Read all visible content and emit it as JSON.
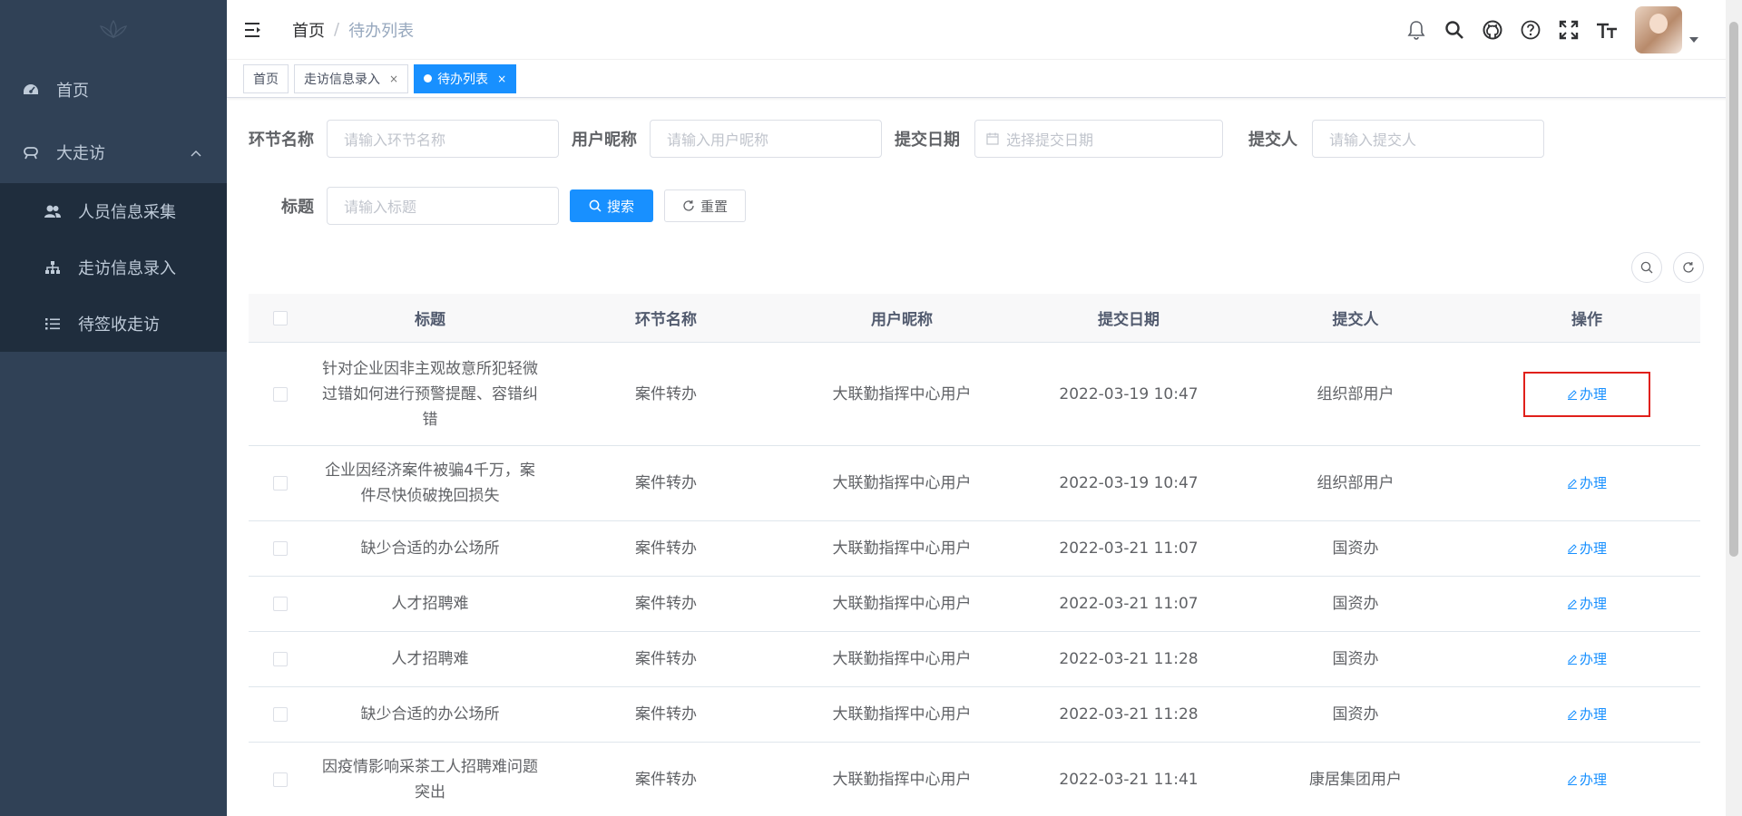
{
  "sidebar": {
    "menu": [
      {
        "label": "首页",
        "icon": "dashboard-icon"
      },
      {
        "label": "大走访",
        "icon": "visit-icon"
      }
    ],
    "submenu": [
      {
        "label": "人员信息采集",
        "icon": "peoples-icon"
      },
      {
        "label": "走访信息录入",
        "icon": "tree-icon"
      },
      {
        "label": "待签收走访",
        "icon": "list-icon"
      }
    ]
  },
  "breadcrumb": {
    "home": "首页",
    "sep": "/",
    "current": "待办列表"
  },
  "tags": [
    {
      "label": "首页"
    },
    {
      "label": "走访信息录入"
    },
    {
      "label": "待办列表"
    }
  ],
  "tag_close": "×",
  "filter": {
    "node_label": "环节名称",
    "node_placeholder": "请输入环节名称",
    "user_label": "用户昵称",
    "user_placeholder": "请输入用户昵称",
    "date_label": "提交日期",
    "date_placeholder": "选择提交日期",
    "submitter_label": "提交人",
    "submitter_placeholder": "请输入提交人",
    "title_label": "标题",
    "title_placeholder": "请输入标题",
    "search_label": "搜索",
    "reset_label": "重置"
  },
  "table": {
    "headers": [
      "标题",
      "环节名称",
      "用户昵称",
      "提交日期",
      "提交人",
      "操作"
    ],
    "op_label": "办理",
    "rows": [
      {
        "title": "针对企业因非主观故意所犯轻微过错如何进行预警提醒、容错纠错",
        "node": "案件转办",
        "user": "大联勤指挥中心用户",
        "date": "2022-03-19 10:47",
        "submitter": "组织部用户"
      },
      {
        "title": "企业因经济案件被骗4千万，案件尽快侦破挽回损失",
        "node": "案件转办",
        "user": "大联勤指挥中心用户",
        "date": "2022-03-19 10:47",
        "submitter": "组织部用户"
      },
      {
        "title": "缺少合适的办公场所",
        "node": "案件转办",
        "user": "大联勤指挥中心用户",
        "date": "2022-03-21 11:07",
        "submitter": "国资办"
      },
      {
        "title": "人才招聘难",
        "node": "案件转办",
        "user": "大联勤指挥中心用户",
        "date": "2022-03-21 11:07",
        "submitter": "国资办"
      },
      {
        "title": "人才招聘难",
        "node": "案件转办",
        "user": "大联勤指挥中心用户",
        "date": "2022-03-21 11:28",
        "submitter": "国资办"
      },
      {
        "title": "缺少合适的办公场所",
        "node": "案件转办",
        "user": "大联勤指挥中心用户",
        "date": "2022-03-21 11:28",
        "submitter": "国资办"
      },
      {
        "title": "因疫情影响采茶工人招聘难问题突出",
        "node": "案件转办",
        "user": "大联勤指挥中心用户",
        "date": "2022-03-21 11:41",
        "submitter": "康居集团用户"
      }
    ]
  },
  "colors": {
    "sidebar": "#304156",
    "primary": "#1890ff",
    "highlight": "#e0201b"
  }
}
